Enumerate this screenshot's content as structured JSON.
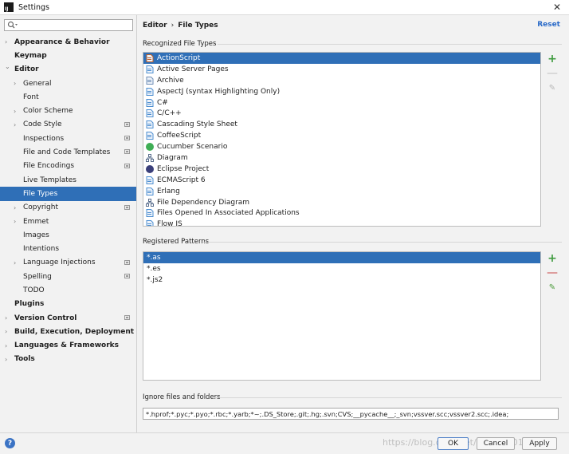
{
  "window": {
    "title": "Settings",
    "app_icon": "IJ"
  },
  "search": {
    "value": "",
    "placeholder": ""
  },
  "tree": [
    {
      "label": "Appearance & Behavior",
      "level": 0,
      "expand": true,
      "bold": true,
      "project": false
    },
    {
      "label": "Keymap",
      "level": 0,
      "expand": false,
      "bold": true,
      "project": false
    },
    {
      "label": "Editor",
      "level": 0,
      "expand": true,
      "bold": true,
      "open": true,
      "project": false
    },
    {
      "label": "General",
      "level": 1,
      "expand": true,
      "project": false
    },
    {
      "label": "Font",
      "level": 1,
      "expand": false,
      "project": false
    },
    {
      "label": "Color Scheme",
      "level": 1,
      "expand": true,
      "project": false
    },
    {
      "label": "Code Style",
      "level": 1,
      "expand": true,
      "project": true
    },
    {
      "label": "Inspections",
      "level": 1,
      "expand": false,
      "project": true
    },
    {
      "label": "File and Code Templates",
      "level": 1,
      "expand": false,
      "project": true
    },
    {
      "label": "File Encodings",
      "level": 1,
      "expand": false,
      "project": true
    },
    {
      "label": "Live Templates",
      "level": 1,
      "expand": false,
      "project": false
    },
    {
      "label": "File Types",
      "level": 1,
      "expand": false,
      "project": false,
      "selected": true
    },
    {
      "label": "Copyright",
      "level": 1,
      "expand": true,
      "project": true
    },
    {
      "label": "Emmet",
      "level": 1,
      "expand": true,
      "project": false
    },
    {
      "label": "Images",
      "level": 1,
      "expand": false,
      "project": false
    },
    {
      "label": "Intentions",
      "level": 1,
      "expand": false,
      "project": false
    },
    {
      "label": "Language Injections",
      "level": 1,
      "expand": true,
      "project": true
    },
    {
      "label": "Spelling",
      "level": 1,
      "expand": false,
      "project": true
    },
    {
      "label": "TODO",
      "level": 1,
      "expand": false,
      "project": false
    },
    {
      "label": "Plugins",
      "level": 0,
      "expand": false,
      "bold": true,
      "project": false
    },
    {
      "label": "Version Control",
      "level": 0,
      "expand": true,
      "bold": true,
      "project": true
    },
    {
      "label": "Build, Execution, Deployment",
      "level": 0,
      "expand": true,
      "bold": true,
      "project": false
    },
    {
      "label": "Languages & Frameworks",
      "level": 0,
      "expand": true,
      "bold": true,
      "project": false
    },
    {
      "label": "Tools",
      "level": 0,
      "expand": true,
      "bold": true,
      "project": false
    }
  ],
  "header": {
    "crumb1": "Editor",
    "separator": "›",
    "crumb2": "File Types",
    "reset": "Reset"
  },
  "recognized": {
    "label": "Recognized File Types",
    "items": [
      {
        "name": "ActionScript",
        "icon": "as-icon",
        "color": "#c0622a",
        "selected": true
      },
      {
        "name": "Active Server Pages",
        "icon": "asp-icon",
        "color": "#4d8fd1"
      },
      {
        "name": "Archive",
        "icon": "archive-icon",
        "color": "#6d8db5"
      },
      {
        "name": "AspectJ (syntax Highlighting Only)",
        "icon": "aspectj-icon",
        "color": "#4d8fd1"
      },
      {
        "name": "C#",
        "icon": "csharp-icon",
        "color": "#4d8fd1"
      },
      {
        "name": "C/C++",
        "icon": "cpp-icon",
        "color": "#4d8fd1"
      },
      {
        "name": "Cascading Style Sheet",
        "icon": "css-icon",
        "color": "#4d8fd1"
      },
      {
        "name": "CoffeeScript",
        "icon": "coffee-icon",
        "color": "#4d8fd1"
      },
      {
        "name": "Cucumber Scenario",
        "icon": "cucumber-icon",
        "color": "#3fae55"
      },
      {
        "name": "Diagram",
        "icon": "diagram-icon",
        "color": "#5b6f8e"
      },
      {
        "name": "Eclipse Project",
        "icon": "eclipse-icon",
        "color": "#3a3f7a"
      },
      {
        "name": "ECMAScript 6",
        "icon": "ecma-icon",
        "color": "#4d8fd1"
      },
      {
        "name": "Erlang",
        "icon": "erlang-icon",
        "color": "#4d8fd1"
      },
      {
        "name": "File Dependency Diagram",
        "icon": "dependency-icon",
        "color": "#5b6f8e"
      },
      {
        "name": "Files Opened In Associated Applications",
        "icon": "external-icon",
        "color": "#4d8fd1"
      },
      {
        "name": "Flow JS",
        "icon": "flow-icon",
        "color": "#4d8fd1"
      }
    ]
  },
  "patterns": {
    "label": "Registered Patterns",
    "items": [
      {
        "value": "*.as",
        "selected": true
      },
      {
        "value": "*.es"
      },
      {
        "value": "*.js2"
      }
    ]
  },
  "ignore": {
    "label": "Ignore files and folders",
    "value": "*.hprof;*.pyc;*.pyo;*.rbc;*.yarb;*~;.DS_Store;.git;.hg;.svn;CVS;__pycache__;_svn;vssver.scc;vssver2.scc;.idea;"
  },
  "buttons": {
    "ok": "OK",
    "cancel": "Cancel",
    "apply": "Apply"
  },
  "help": "?",
  "watermark": "https://blog.csdn.net/loktauf2019",
  "colors": {
    "selection": "#2f6fb7",
    "link": "#2a6ac8",
    "add": "#3d9a3d",
    "remove": "#c84848"
  }
}
